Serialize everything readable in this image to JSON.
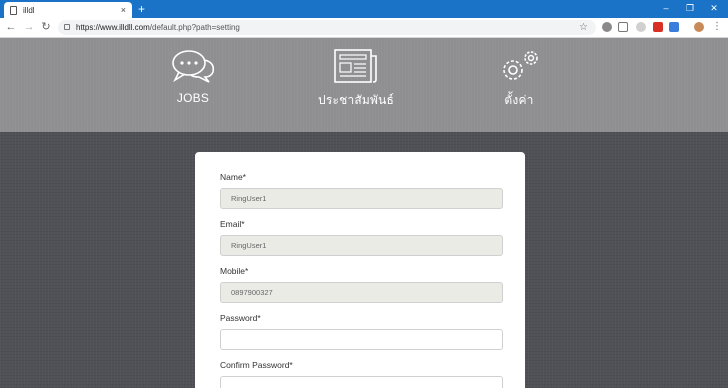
{
  "browser": {
    "tab_title": "illdl",
    "tab_close": "×",
    "new_tab": "+",
    "url_host": "https://www.illdll.com",
    "url_path": "/default.php?path=setting",
    "win_min": "–",
    "win_max": "❐",
    "win_close": "✕"
  },
  "nav": {
    "jobs": "JOBS",
    "news": "ประชาสัมพันธ์",
    "settings": "ตั้งค่า"
  },
  "form": {
    "name_label": "Name*",
    "name_value": "RingUser1",
    "email_label": "Email*",
    "email_value": "RingUser1",
    "mobile_label": "Mobile*",
    "mobile_value": "0897900327",
    "password_label": "Password*",
    "password_value": "",
    "confirm_label": "Confirm Password*",
    "confirm_value": ""
  },
  "colors": {
    "tabbar": "#1a73c7",
    "hero": "#8f8f92",
    "background": "#505156",
    "readonly_input": "#ebebe6"
  }
}
